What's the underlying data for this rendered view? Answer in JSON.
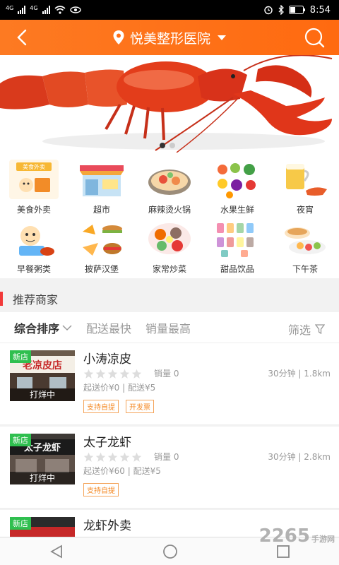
{
  "status": {
    "left_net1": "4G",
    "left_net2": "4G",
    "time": "8:54"
  },
  "header": {
    "location": "悦美整形医院",
    "back_icon": "chevron-left-icon",
    "search_icon": "search-icon",
    "accent": "#ff6e16"
  },
  "banner": {
    "dots": 2,
    "active_dot": 1
  },
  "categories": [
    {
      "label": "美食外卖"
    },
    {
      "label": "超市"
    },
    {
      "label": "麻辣烫火锅"
    },
    {
      "label": "水果生鲜"
    },
    {
      "label": "夜宵"
    },
    {
      "label": "早餐粥类"
    },
    {
      "label": "披萨汉堡"
    },
    {
      "label": "家常炒菜"
    },
    {
      "label": "甜品饮品"
    },
    {
      "label": "下午茶"
    }
  ],
  "section": {
    "title": "推荐商家"
  },
  "sort": {
    "options": [
      "综合排序",
      "配送最快",
      "销量最高"
    ],
    "filter_label": "筛选"
  },
  "stores": [
    {
      "badge": "新店",
      "sign_text": "老凉皮店",
      "status": "打烊中",
      "name": "小涛凉皮",
      "sales": "销量 0",
      "eta": "30分钟 | 1.8km",
      "fee": "起送价¥0 | 配送¥5",
      "tags": [
        "支持自提",
        "开发票"
      ]
    },
    {
      "badge": "新店",
      "sign_text": "太子龙虾",
      "status": "打烊中",
      "name": "太子龙虾",
      "sales": "销量 0",
      "eta": "30分钟 | 2.8km",
      "fee": "起送价¥60 | 配送¥5",
      "tags": [
        "支持自提"
      ]
    },
    {
      "badge": "新店",
      "name": "龙虾外卖"
    }
  ],
  "watermark": {
    "brand": "2265",
    "sub": "手游网"
  }
}
